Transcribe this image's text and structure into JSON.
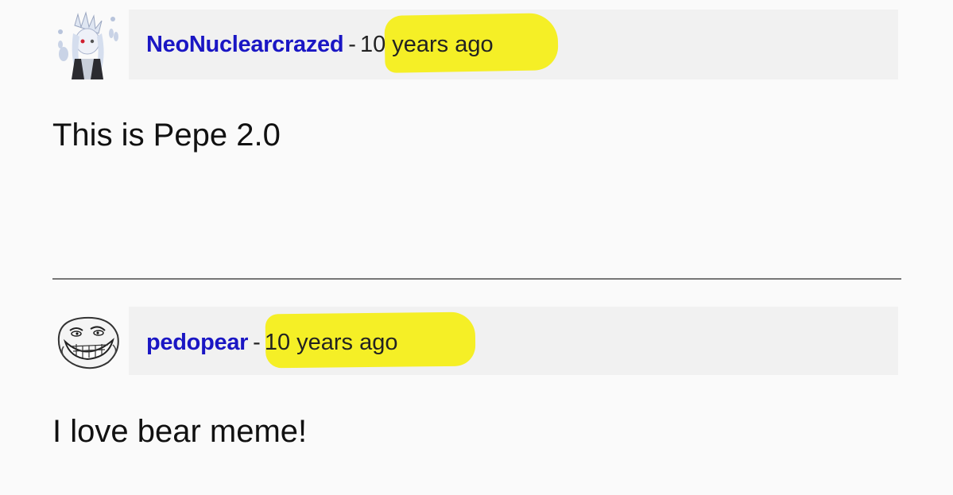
{
  "comments": [
    {
      "avatar_icon": "anime-character-avatar-icon",
      "username": "NeoNuclearcrazed",
      "separator": "-",
      "time": "10 years ago",
      "body": "This is Pepe 2.0"
    },
    {
      "avatar_icon": "trollface-avatar-icon",
      "username": "pedopear",
      "separator": "-",
      "time": "10 years ago",
      "body": "I love bear meme!"
    }
  ],
  "colors": {
    "username": "#1a16c4",
    "highlight": "#f4ee1a",
    "header_background": "#f1f1f1"
  }
}
